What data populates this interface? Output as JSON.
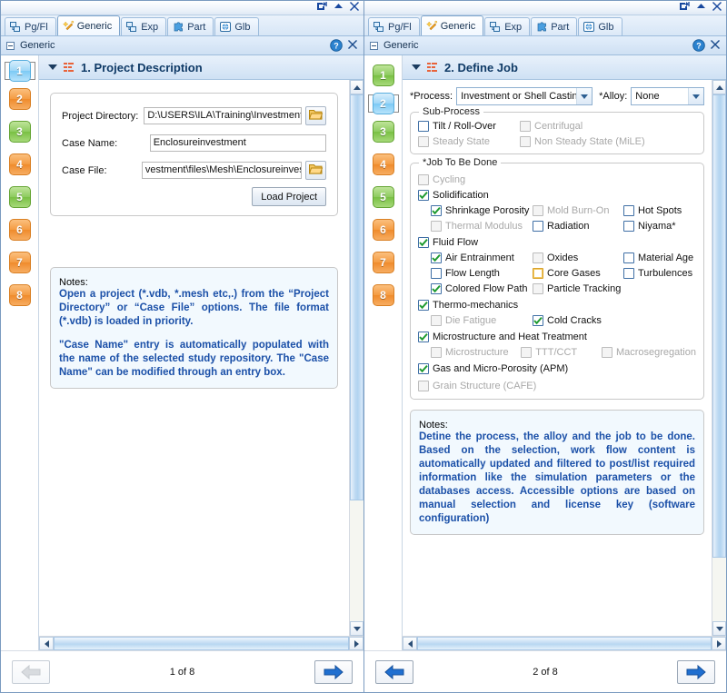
{
  "tabs": [
    {
      "label": "Pg/Fl",
      "icon": "pages-icon",
      "active": false
    },
    {
      "label": "Generic",
      "icon": "wand-icon",
      "active": true
    },
    {
      "label": "Exp",
      "icon": "pages-icon",
      "active": false
    },
    {
      "label": "Part",
      "icon": "puzzle-icon",
      "active": false
    },
    {
      "label": "Glb",
      "icon": "globe-icon",
      "active": false
    }
  ],
  "window_controls": {
    "restore": "restore-icon",
    "minimize": "collapse-icon",
    "close": "close-icon"
  },
  "caption": {
    "title": "Generic",
    "help": "help-icon",
    "close": "close-icon"
  },
  "left": {
    "steps": [
      {
        "n": "1",
        "color": "blue",
        "selected": true
      },
      {
        "n": "2",
        "color": "orange",
        "selected": false
      },
      {
        "n": "3",
        "color": "green",
        "selected": false
      },
      {
        "n": "4",
        "color": "orange",
        "selected": false
      },
      {
        "n": "5",
        "color": "green",
        "selected": false
      },
      {
        "n": "6",
        "color": "orange",
        "selected": false
      },
      {
        "n": "7",
        "color": "orange",
        "selected": false
      },
      {
        "n": "8",
        "color": "orange",
        "selected": false
      }
    ],
    "section_title": "1. Project Description",
    "fields": {
      "project_directory_label": "Project Directory:",
      "project_directory_value": "D:\\USERS\\ILA\\Training\\Investment\\files\\Me",
      "case_name_label": "Case Name:",
      "case_name_value": "Enclosureinvestment",
      "case_file_label": "Case File:",
      "case_file_value": "vestment\\files\\Mesh\\Enclosureinvestment.sm",
      "load_project_label": "Load Project",
      "browse_icon": "folder-open-icon"
    },
    "notes": {
      "caption": "Notes:",
      "paragraphs": [
        "Open a project (*.vdb, *.mesh etc,.) from the “Project Directory” or “Case File” options.  The file format (*.vdb) is loaded in priority.",
        "\"Case Name\" entry is automatically populated with the name of the selected study repository. The \"Case Name\" can be modified through an entry box."
      ]
    },
    "nav": {
      "prev": "arrow-left-icon",
      "next": "arrow-right-icon",
      "page_label": "1 of 8",
      "prev_enabled": false,
      "next_enabled": true
    }
  },
  "right": {
    "steps": [
      {
        "n": "1",
        "color": "green",
        "selected": false
      },
      {
        "n": "2",
        "color": "blue",
        "selected": true
      },
      {
        "n": "3",
        "color": "green",
        "selected": false
      },
      {
        "n": "4",
        "color": "orange",
        "selected": false
      },
      {
        "n": "5",
        "color": "green",
        "selected": false
      },
      {
        "n": "6",
        "color": "orange",
        "selected": false
      },
      {
        "n": "7",
        "color": "orange",
        "selected": false
      },
      {
        "n": "8",
        "color": "orange",
        "selected": false
      }
    ],
    "section_title": "2. Define Job",
    "process": {
      "label": "*Process:",
      "value": "Investment or Shell Casting"
    },
    "alloy": {
      "label": "*Alloy:",
      "value": "None"
    },
    "subprocess": {
      "caption": "Sub-Process",
      "items": [
        {
          "label": "Tilt / Roll-Over",
          "checked": false,
          "disabled": false
        },
        {
          "label": "Centrifugal",
          "checked": false,
          "disabled": true
        },
        {
          "label": "Steady State",
          "checked": false,
          "disabled": true
        },
        {
          "label": "Non Steady State (MiLE)",
          "checked": false,
          "disabled": true
        }
      ]
    },
    "job": {
      "caption": "*Job To Be Done",
      "cycling": {
        "label": "Cycling",
        "checked": false,
        "disabled": true
      },
      "solidification": {
        "label": "Solidification",
        "checked": true,
        "disabled": false
      },
      "solidification_children": [
        {
          "label": "Shrinkage Porosity",
          "checked": true,
          "disabled": false
        },
        {
          "label": "Mold Burn-On",
          "checked": false,
          "disabled": true
        },
        {
          "label": "Hot Spots",
          "checked": false,
          "disabled": false
        },
        {
          "label": "Thermal Modulus",
          "checked": false,
          "disabled": true
        },
        {
          "label": "Radiation",
          "checked": false,
          "disabled": false
        },
        {
          "label": "Niyama*",
          "checked": false,
          "disabled": false
        }
      ],
      "fluid_flow": {
        "label": "Fluid Flow",
        "checked": true,
        "disabled": false
      },
      "fluid_flow_children": [
        {
          "label": "Air Entrainment",
          "checked": true,
          "disabled": false
        },
        {
          "label": "Oxides",
          "checked": false,
          "disabled": true
        },
        {
          "label": "Material Age",
          "checked": false,
          "disabled": false
        },
        {
          "label": "Flow Length",
          "checked": false,
          "disabled": false
        },
        {
          "label": "Core Gases",
          "checked": false,
          "disabled": false,
          "highlight": true
        },
        {
          "label": "Turbulences",
          "checked": false,
          "disabled": false
        },
        {
          "label": "Colored Flow Path",
          "checked": true,
          "disabled": false
        },
        {
          "label": "Particle Tracking",
          "checked": false,
          "disabled": true
        }
      ],
      "thermo": {
        "label": "Thermo-mechanics",
        "checked": true,
        "disabled": false
      },
      "thermo_children": [
        {
          "label": "Die Fatigue",
          "checked": false,
          "disabled": true
        },
        {
          "label": "Cold Cracks",
          "checked": true,
          "disabled": false
        }
      ],
      "micro": {
        "label": "Microstructure and Heat Treatment",
        "checked": true,
        "disabled": false
      },
      "micro_children": [
        {
          "label": "Microstructure",
          "checked": false,
          "disabled": true
        },
        {
          "label": "TTT/CCT",
          "checked": false,
          "disabled": true
        },
        {
          "label": "Macrosegregation",
          "checked": false,
          "disabled": true
        }
      ],
      "apm": {
        "label": "Gas and Micro-Porosity (APM)",
        "checked": true,
        "disabled": false
      },
      "cafe": {
        "label": "Grain Structure (CAFE)",
        "checked": false,
        "disabled": true
      }
    },
    "notes": {
      "caption": "Notes:",
      "paragraphs": [
        "Detine the process, the alloy and the job to be done. Based on the selection, work flow content is automatically updated and filtered to post/list required information like the simulation parameters or the databases access. Accessible options are based on manual selection and license key (software configuration)"
      ]
    },
    "nav": {
      "prev": "arrow-left-icon",
      "next": "arrow-right-icon",
      "page_label": "2 of 8",
      "prev_enabled": true,
      "next_enabled": true
    }
  }
}
